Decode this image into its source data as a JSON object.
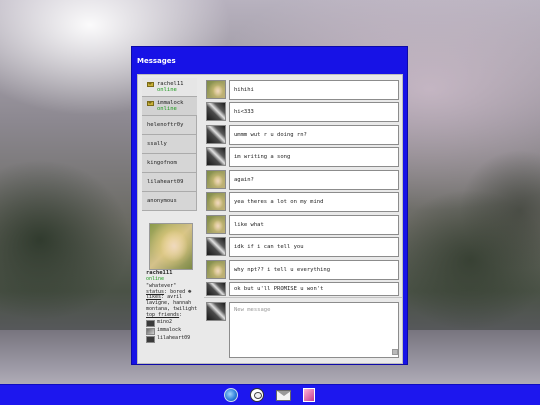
{
  "window": {
    "title": "Messages"
  },
  "contacts": [
    {
      "name": "rachel11",
      "status": "online",
      "unread": true
    },
    {
      "name": "immalock",
      "status": "online",
      "unread": true
    },
    {
      "name": "helenoftr0y"
    },
    {
      "name": "ssally"
    },
    {
      "name": "kingofnom"
    },
    {
      "name": "lilaheart09"
    },
    {
      "name": "anonymous"
    }
  ],
  "profile": {
    "name": "rache111",
    "status": "online",
    "quote": "\"whatever\"",
    "status_label": "status",
    "status_text": ": bored",
    "likes_label": "likes",
    "likes_text": ": avril lavigne, hannah montana, twilight",
    "friends_label": "top friends",
    "friends": [
      "mino2",
      "immalock",
      "lilaheart09"
    ]
  },
  "messages": [
    {
      "avatar": "blonde",
      "text": "hihihi"
    },
    {
      "avatar": "dark",
      "text": "hi<333"
    },
    {
      "avatar": "dark",
      "text": "ummm wut r u doing rn?"
    },
    {
      "avatar": "dark",
      "text": "im writing a song"
    },
    {
      "avatar": "blonde",
      "text": "again?"
    },
    {
      "avatar": "blonde",
      "text": "yea theres a lot on my mind"
    },
    {
      "avatar": "blonde",
      "text": "like what"
    },
    {
      "avatar": "dark",
      "text": "idk if i can tell you"
    },
    {
      "avatar": "blonde",
      "text": "why npt?? i tell u everything"
    },
    {
      "avatar": "dark",
      "text": "ok but u'll PROMISE u won't"
    }
  ],
  "compose": {
    "placeholder": "New message"
  },
  "taskbar": [
    {
      "icon": "globe-icon"
    },
    {
      "icon": "chat-icon"
    },
    {
      "icon": "mail-icon"
    },
    {
      "icon": "user-icon"
    }
  ]
}
